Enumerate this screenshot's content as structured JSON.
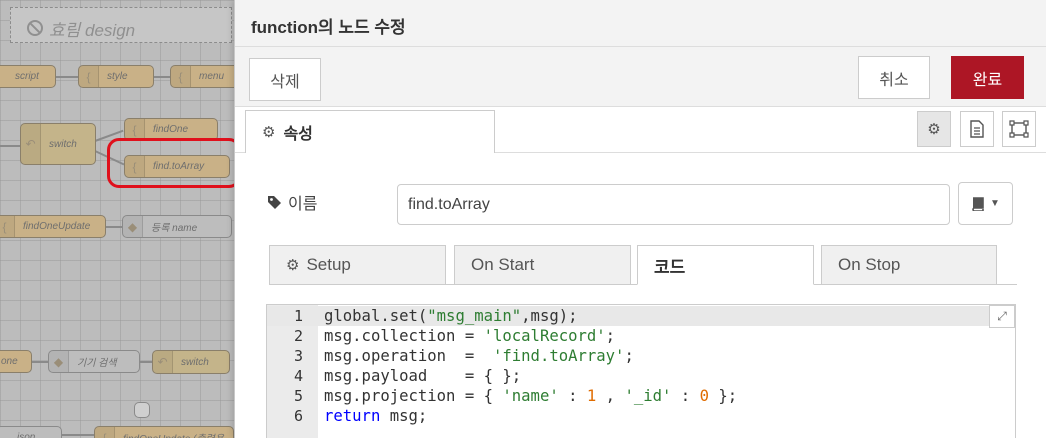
{
  "canvas": {
    "flow_title": "효림 design",
    "nodes": {
      "script": "script",
      "style": "style",
      "menu": "menu",
      "switch": "switch",
      "find_one": "findOne",
      "find_to_array": "find.toArray",
      "find_one_update": "findOneUpdate",
      "register_name": "등록 name",
      "node_one": "one",
      "search": "기기 검색",
      "switch2": "switch",
      "json": "json",
      "find_one_update_output": "findOneUpdate (출력용"
    }
  },
  "tray": {
    "title": "function의 노드 수정",
    "delete_label": "삭제",
    "cancel_label": "취소",
    "done_label": "완료",
    "properties_tab": "속성",
    "name_label": "이름",
    "name_value": "find.toArray",
    "code_tabs": {
      "setup": "Setup",
      "on_start": "On Start",
      "code": "코드",
      "on_stop": "On Stop"
    },
    "code_lines": {
      "l1": {
        "n": "1",
        "text": "global.set(\"msg_main\",msg);"
      },
      "l2": {
        "n": "2",
        "text": "msg.collection = 'localRecord';"
      },
      "l3": {
        "n": "3",
        "text": "msg.operation  =  'find.toArray';"
      },
      "l4": {
        "n": "4",
        "text": "msg.payload    = { };"
      },
      "l5": {
        "n": "5",
        "text": "msg.projection = { 'name' : 1 , '_id' : 0 };"
      },
      "l6": {
        "n": "6",
        "text": "return msg;"
      }
    }
  },
  "colors": {
    "done_button": "#ad1625",
    "highlight_ring": "#e0101c",
    "string_token": "#2e7d32",
    "number_token": "#e06c00",
    "keyword_token": "#0000ff"
  },
  "icons": [
    "ban-icon",
    "function-icon",
    "switch-icon",
    "gear-icon",
    "tag-icon",
    "book-icon",
    "caret-down-icon",
    "document-icon",
    "frame-icon",
    "expand-icon"
  ]
}
